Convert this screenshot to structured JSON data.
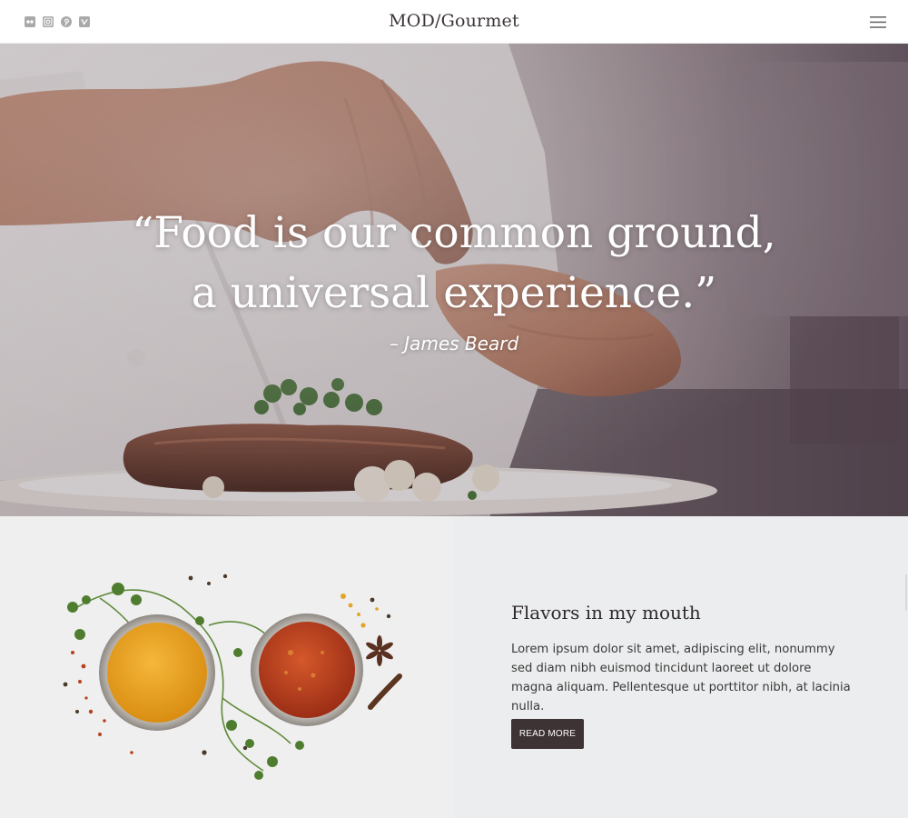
{
  "header": {
    "brand": "MOD/Gourmet",
    "social_icons": [
      "flickr-icon",
      "instagram-icon",
      "pinterest-icon",
      "vimeo-icon"
    ],
    "menu_icon": "hamburger-menu-icon"
  },
  "hero": {
    "quote_line1": "“Food is our common ground,",
    "quote_line2": "a universal experience.”",
    "author": "– James Beard"
  },
  "feature": {
    "title": "Flavors in my mouth",
    "body": "Lorem ipsum dolor sit amet, adipiscing elit, nonummy sed diam nibh euismod tincidunt laoreet ut dolore magna aliquam. Pellentesque ut porttitor nibh, at lacinia nulla.",
    "button_label": "READ MORE"
  },
  "colors": {
    "button_bg": "#3d3234",
    "section_bg": "#ecedee",
    "brand_text": "#3b3537"
  }
}
